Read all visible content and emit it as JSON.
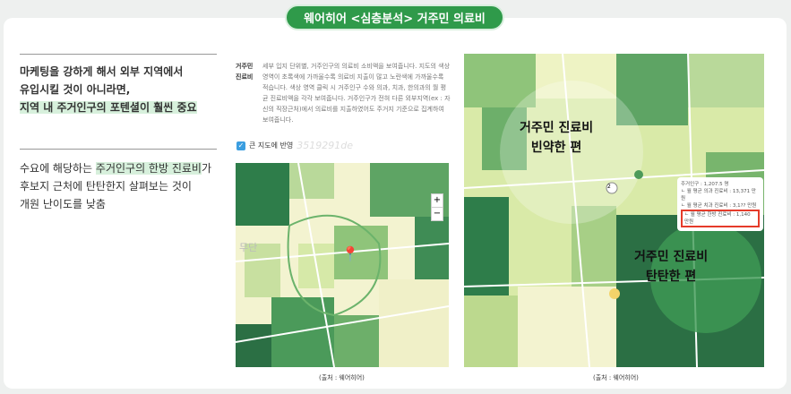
{
  "title": "웨어히어 <심층분석> 거주민 의료비",
  "left": {
    "p1": [
      "마케팅을 강하게 해서 외부 지역에서",
      "유입시킬 것이 아니라면,",
      "지역 내 주거인구의 포텐셜이 훨씬 중요"
    ],
    "p2": [
      "수요에 해당하는 ",
      "주거인구의 한방 진료비",
      "가",
      "후보지 근처에 탄탄한지 살펴보는 것이",
      "개원 난이도를 낮춤"
    ]
  },
  "desc": {
    "label": "거주민 진료비",
    "text": "세부 입지 단위별, 거주인구의 의료비 소비액을 보여줍니다. 지도의 색상 영역이 초록색에 가까울수록 의료비 지출이 많고 노란색에 가까울수록 적습니다. 색상 영역 클릭 시 거주인구 수와 의과, 치과, 한의과의 월 평균 진료비액을 각각 보여줍니다. 거주인구가 전혀 다른 외부지역(ex : 자신의 직장근처)에서 의료비를 지출하였어도 주거지 기준으로 집계하여 보여줍니다.",
    "checkbox": "큰 지도에 반영",
    "watermark": "3519291de"
  },
  "small_map": {
    "zoom_in": "+",
    "zoom_out": "−",
    "place": "무단"
  },
  "big_map": {
    "label_weak": [
      "거주민 진료비",
      "빈약한 편"
    ],
    "label_strong": [
      "거주민 진료비",
      "탄탄한 편"
    ],
    "cluster": "2",
    "tooltip": [
      "주거인구 : 1,207.5 명",
      "ㄴ 월 평균 의과 진료비 : 13,371 만원",
      "ㄴ 월 평균 치과 진료비 : 3,1?? 만원",
      "ㄴ 월 평균 한방 진료비 : 1,140 만원"
    ]
  },
  "caption": "(출처 : 웨어히어)",
  "colors": {
    "accent": "#2f9a4a",
    "highlight": "#e53b2a"
  }
}
